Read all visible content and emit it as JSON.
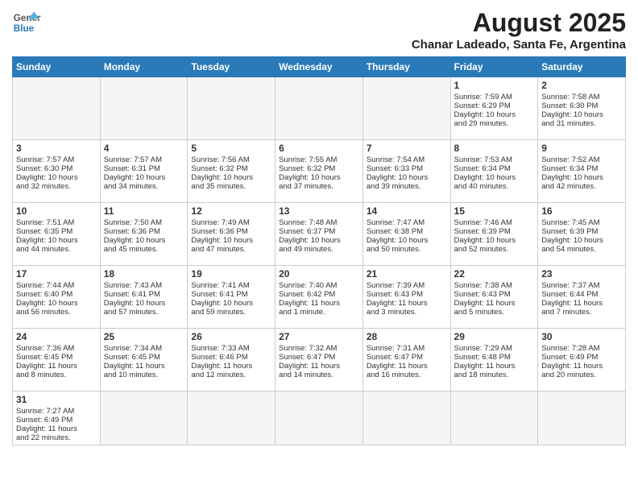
{
  "header": {
    "logo_line1": "General",
    "logo_line2": "Blue",
    "title": "August 2025",
    "subtitle": "Chanar Ladeado, Santa Fe, Argentina"
  },
  "weekdays": [
    "Sunday",
    "Monday",
    "Tuesday",
    "Wednesday",
    "Thursday",
    "Friday",
    "Saturday"
  ],
  "weeks": [
    [
      {
        "day": "",
        "info": ""
      },
      {
        "day": "",
        "info": ""
      },
      {
        "day": "",
        "info": ""
      },
      {
        "day": "",
        "info": ""
      },
      {
        "day": "",
        "info": ""
      },
      {
        "day": "1",
        "info": "Sunrise: 7:59 AM\nSunset: 6:29 PM\nDaylight: 10 hours\nand 29 minutes."
      },
      {
        "day": "2",
        "info": "Sunrise: 7:58 AM\nSunset: 6:30 PM\nDaylight: 10 hours\nand 31 minutes."
      }
    ],
    [
      {
        "day": "3",
        "info": "Sunrise: 7:57 AM\nSunset: 6:30 PM\nDaylight: 10 hours\nand 32 minutes."
      },
      {
        "day": "4",
        "info": "Sunrise: 7:57 AM\nSunset: 6:31 PM\nDaylight: 10 hours\nand 34 minutes."
      },
      {
        "day": "5",
        "info": "Sunrise: 7:56 AM\nSunset: 6:32 PM\nDaylight: 10 hours\nand 35 minutes."
      },
      {
        "day": "6",
        "info": "Sunrise: 7:55 AM\nSunset: 6:32 PM\nDaylight: 10 hours\nand 37 minutes."
      },
      {
        "day": "7",
        "info": "Sunrise: 7:54 AM\nSunset: 6:33 PM\nDaylight: 10 hours\nand 39 minutes."
      },
      {
        "day": "8",
        "info": "Sunrise: 7:53 AM\nSunset: 6:34 PM\nDaylight: 10 hours\nand 40 minutes."
      },
      {
        "day": "9",
        "info": "Sunrise: 7:52 AM\nSunset: 6:34 PM\nDaylight: 10 hours\nand 42 minutes."
      }
    ],
    [
      {
        "day": "10",
        "info": "Sunrise: 7:51 AM\nSunset: 6:35 PM\nDaylight: 10 hours\nand 44 minutes."
      },
      {
        "day": "11",
        "info": "Sunrise: 7:50 AM\nSunset: 6:36 PM\nDaylight: 10 hours\nand 45 minutes."
      },
      {
        "day": "12",
        "info": "Sunrise: 7:49 AM\nSunset: 6:36 PM\nDaylight: 10 hours\nand 47 minutes."
      },
      {
        "day": "13",
        "info": "Sunrise: 7:48 AM\nSunset: 6:37 PM\nDaylight: 10 hours\nand 49 minutes."
      },
      {
        "day": "14",
        "info": "Sunrise: 7:47 AM\nSunset: 6:38 PM\nDaylight: 10 hours\nand 50 minutes."
      },
      {
        "day": "15",
        "info": "Sunrise: 7:46 AM\nSunset: 6:39 PM\nDaylight: 10 hours\nand 52 minutes."
      },
      {
        "day": "16",
        "info": "Sunrise: 7:45 AM\nSunset: 6:39 PM\nDaylight: 10 hours\nand 54 minutes."
      }
    ],
    [
      {
        "day": "17",
        "info": "Sunrise: 7:44 AM\nSunset: 6:40 PM\nDaylight: 10 hours\nand 56 minutes."
      },
      {
        "day": "18",
        "info": "Sunrise: 7:43 AM\nSunset: 6:41 PM\nDaylight: 10 hours\nand 57 minutes."
      },
      {
        "day": "19",
        "info": "Sunrise: 7:41 AM\nSunset: 6:41 PM\nDaylight: 10 hours\nand 59 minutes."
      },
      {
        "day": "20",
        "info": "Sunrise: 7:40 AM\nSunset: 6:42 PM\nDaylight: 11 hours\nand 1 minute."
      },
      {
        "day": "21",
        "info": "Sunrise: 7:39 AM\nSunset: 6:43 PM\nDaylight: 11 hours\nand 3 minutes."
      },
      {
        "day": "22",
        "info": "Sunrise: 7:38 AM\nSunset: 6:43 PM\nDaylight: 11 hours\nand 5 minutes."
      },
      {
        "day": "23",
        "info": "Sunrise: 7:37 AM\nSunset: 6:44 PM\nDaylight: 11 hours\nand 7 minutes."
      }
    ],
    [
      {
        "day": "24",
        "info": "Sunrise: 7:36 AM\nSunset: 6:45 PM\nDaylight: 11 hours\nand 8 minutes."
      },
      {
        "day": "25",
        "info": "Sunrise: 7:34 AM\nSunset: 6:45 PM\nDaylight: 11 hours\nand 10 minutes."
      },
      {
        "day": "26",
        "info": "Sunrise: 7:33 AM\nSunset: 6:46 PM\nDaylight: 11 hours\nand 12 minutes."
      },
      {
        "day": "27",
        "info": "Sunrise: 7:32 AM\nSunset: 6:47 PM\nDaylight: 11 hours\nand 14 minutes."
      },
      {
        "day": "28",
        "info": "Sunrise: 7:31 AM\nSunset: 6:47 PM\nDaylight: 11 hours\nand 16 minutes."
      },
      {
        "day": "29",
        "info": "Sunrise: 7:29 AM\nSunset: 6:48 PM\nDaylight: 11 hours\nand 18 minutes."
      },
      {
        "day": "30",
        "info": "Sunrise: 7:28 AM\nSunset: 6:49 PM\nDaylight: 11 hours\nand 20 minutes."
      }
    ],
    [
      {
        "day": "31",
        "info": "Sunrise: 7:27 AM\nSunset: 6:49 PM\nDaylight: 11 hours\nand 22 minutes."
      },
      {
        "day": "",
        "info": ""
      },
      {
        "day": "",
        "info": ""
      },
      {
        "day": "",
        "info": ""
      },
      {
        "day": "",
        "info": ""
      },
      {
        "day": "",
        "info": ""
      },
      {
        "day": "",
        "info": ""
      }
    ]
  ]
}
